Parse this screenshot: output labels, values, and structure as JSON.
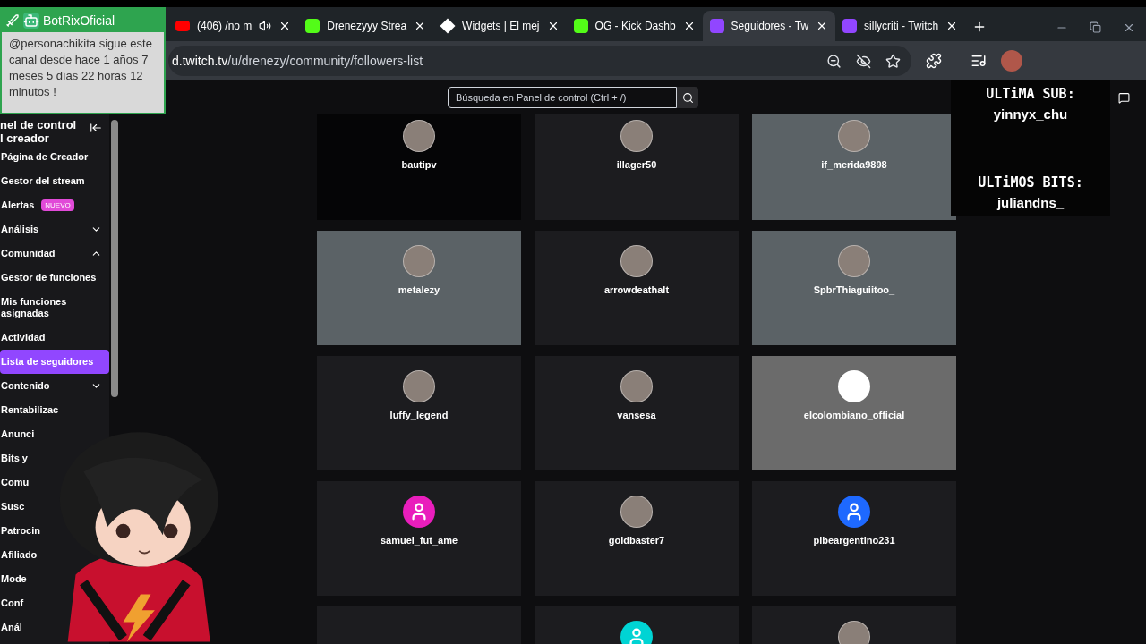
{
  "browser": {
    "tabs": [
      {
        "title": "(406) /no m",
        "kind": "youtube",
        "audio": true,
        "selected": false
      },
      {
        "title": "Drenezyyy Strea",
        "kind": "kick",
        "audio": false,
        "selected": false
      },
      {
        "title": "Widgets | El mej",
        "kind": "widgets",
        "audio": false,
        "selected": false
      },
      {
        "title": "OG - Kick Dashb",
        "kind": "kick",
        "audio": false,
        "selected": false
      },
      {
        "title": "Seguidores - Tw",
        "kind": "twitch",
        "audio": false,
        "selected": true
      },
      {
        "title": "sillycriti - Twitch",
        "kind": "twitch",
        "audio": false,
        "selected": false
      }
    ],
    "url_host": "d.twitch.tv",
    "url_path": "/u/drenezy/community/followers-list"
  },
  "search": {
    "placeholder": "Búsqueda en Panel de control (Ctrl + /)"
  },
  "sidebar": {
    "title_lines": [
      "nel de control",
      "l creador"
    ],
    "items": [
      {
        "label": "Página de Creador",
        "selected": false
      },
      {
        "label": "Gestor del stream",
        "selected": false
      },
      {
        "label": "Alertas",
        "badge": "NUEVO",
        "selected": false
      },
      {
        "label": "Análisis",
        "expanded": false,
        "selected": false
      },
      {
        "label": "Comunidad",
        "expanded": true,
        "selected": false
      },
      {
        "label": "Gestor de funciones",
        "selected": false
      },
      {
        "label": "Mis funciones asignadas",
        "selected": false
      },
      {
        "label": "Actividad",
        "selected": false
      },
      {
        "label": "Lista de seguidores",
        "selected": true
      },
      {
        "label": "Contenido",
        "expanded": false,
        "selected": false
      },
      {
        "label": "Rentabilizac",
        "selected": false
      },
      {
        "label": "Anunci",
        "selected": false
      },
      {
        "label": "Bits y",
        "selected": false
      },
      {
        "label": "Comu",
        "selected": false
      },
      {
        "label": "Susc",
        "selected": false
      },
      {
        "label": "Patrocin",
        "selected": false
      },
      {
        "label": "Afiliado",
        "selected": false
      },
      {
        "label": "Mode",
        "selected": false
      },
      {
        "label": "Conf",
        "selected": false
      },
      {
        "label": "Anál",
        "selected": false
      }
    ]
  },
  "followers": [
    {
      "name": "bautipv",
      "banner": {
        "kind": "black"
      },
      "kind": "photo"
    },
    {
      "name": "illager50",
      "banner": {
        "kind": "dark"
      },
      "kind": "photo"
    },
    {
      "name": "if_merida9898",
      "banner": {
        "kind": "image"
      },
      "kind": "photo"
    },
    {
      "name": "metalezy",
      "banner": {
        "kind": "image"
      },
      "kind": "photo"
    },
    {
      "name": "arrowdeathalt",
      "banner": {
        "kind": "dark"
      },
      "kind": "photo"
    },
    {
      "name": "SpbrThiaguiitoo_",
      "banner": {
        "kind": "image"
      },
      "kind": "photo"
    },
    {
      "name": "luffy_legend",
      "banner": {
        "kind": "dark"
      },
      "kind": "photo"
    },
    {
      "name": "vansesa",
      "banner": {
        "kind": "dark"
      },
      "kind": "photo"
    },
    {
      "name": "elcolombiano_official",
      "banner": {
        "kind": "grey"
      },
      "kind": "blank"
    },
    {
      "name": "samuel_fut_ame",
      "banner": {
        "kind": "dark"
      },
      "kind": "default",
      "color": "#e91ebc"
    },
    {
      "name": "goldbaster7",
      "banner": {
        "kind": "dark"
      },
      "kind": "photo"
    },
    {
      "name": "pibeargentino231",
      "banner": {
        "kind": "dark"
      },
      "kind": "default",
      "color": "#1e69ff"
    },
    {
      "banner": {
        "kind": "dark"
      },
      "kind": "none"
    },
    {
      "banner": {
        "kind": "dark"
      },
      "kind": "default",
      "color": "#00d4d4"
    },
    {
      "banner": {
        "kind": "dark"
      },
      "kind": "photo"
    }
  ],
  "notification": {
    "app": "BotRixOficial",
    "message": "@personachikita sigue este canal desde hace 1 años 7 meses 5 días 22 horas 12 minutos !"
  },
  "stream_overlay": [
    {
      "heading": "ULTiMA SUB:",
      "name": "yinnyx_chu"
    },
    {
      "heading": "ULTiMOS BITS:",
      "name": "juliandns_"
    }
  ]
}
